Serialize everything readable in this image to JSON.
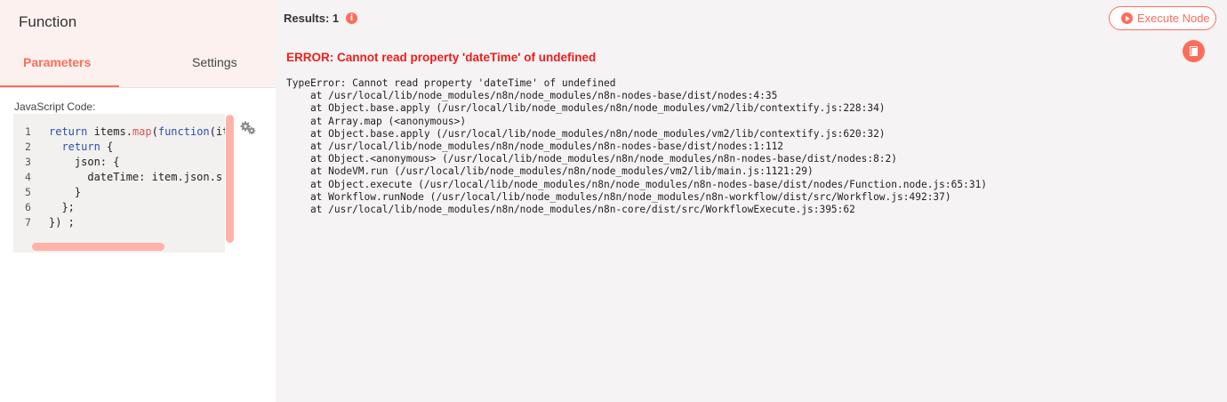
{
  "node": {
    "title": "Function"
  },
  "tabs": [
    {
      "label": "Parameters",
      "active": true
    },
    {
      "label": "Settings",
      "active": false
    }
  ],
  "parameter": {
    "label": "JavaScript Code:",
    "settings_icon": "gears-icon"
  },
  "code_lines": [
    {
      "num": "1",
      "text": "return items.map(function(ite"
    },
    {
      "num": "2",
      "text": "  return {"
    },
    {
      "num": "3",
      "text": "    json: {"
    },
    {
      "num": "4",
      "text": "      dateTime: item.json.s"
    },
    {
      "num": "5",
      "text": "    }"
    },
    {
      "num": "6",
      "text": "  };"
    },
    {
      "num": "7",
      "text": "}) ;"
    }
  ],
  "results": {
    "label": "Results: 1",
    "info_icon": "info-icon"
  },
  "execute_button": {
    "label": "Execute Node",
    "icon": "play-icon"
  },
  "copy_button": {
    "icon": "copy-icon"
  },
  "error": {
    "title": "ERROR: Cannot read property 'dateTime' of undefined",
    "stack": [
      "TypeError: Cannot read property 'dateTime' of undefined",
      "    at /usr/local/lib/node_modules/n8n/node_modules/n8n-nodes-base/dist/nodes:4:35",
      "    at Object.base.apply (/usr/local/lib/node_modules/n8n/node_modules/vm2/lib/contextify.js:228:34)",
      "    at Array.map (<anonymous>)",
      "    at Object.base.apply (/usr/local/lib/node_modules/n8n/node_modules/vm2/lib/contextify.js:620:32)",
      "    at /usr/local/lib/node_modules/n8n/node_modules/n8n-nodes-base/dist/nodes:1:112",
      "    at Object.<anonymous> (/usr/local/lib/node_modules/n8n/node_modules/n8n-nodes-base/dist/nodes:8:2)",
      "    at NodeVM.run (/usr/local/lib/node_modules/n8n/node_modules/vm2/lib/main.js:1121:29)",
      "    at Object.execute (/usr/local/lib/node_modules/n8n/node_modules/n8n-nodes-base/dist/nodes/Function.node.js:65:31)",
      "    at Workflow.runNode (/usr/local/lib/node_modules/n8n/node_modules/n8n-workflow/dist/src/Workflow.js:492:37)",
      "    at /usr/local/lib/node_modules/n8n/node_modules/n8n-core/dist/src/WorkflowExecute.js:395:62"
    ]
  },
  "colors": {
    "accent": "#ff6d5a",
    "error": "#ee1d1d",
    "header_bg": "#fdf1ef",
    "panel_bg": "#f5f3f3"
  }
}
